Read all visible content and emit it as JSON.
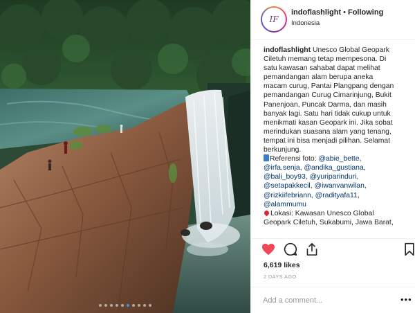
{
  "post": {
    "username": "indoflashlight",
    "separator": "•",
    "follow_label": "Following",
    "location": "Indonesia",
    "avatar_text": "IF",
    "caption": {
      "username": "indoflashlight",
      "lines": [
        " Unesco Global Geopark",
        "Ciletuh memang tetap mempesona. Di",
        "satu kawasan sahabat dapat melihat",
        "pemandangan alam berupa aneka",
        "macam curug, Pantai Plangpang dengan",
        "pemandangan Curug Cimarinjung, Bukit",
        "Panenjoan, Puncak Darma, dan masih",
        "banyak lagi. Satu hari tidak cukup untuk",
        "menikmati kasan Geopark ini. Jika sobat",
        "merindukan suasana alam yang tenang,",
        "tempat ini bisa menjadi pilihan. Selamat",
        "berkunjung."
      ],
      "credit_label": "Referensi foto: ",
      "mentions": [
        "@abie_bette",
        "@irfa.senja",
        "@andika_gustiana",
        "@bali_boy93",
        "@yuriparinduri",
        "@setapakkecil",
        "@iwanvanwilan",
        "@rizkiifebriann",
        "@radityafa11",
        "@alammumu"
      ],
      "location_label": "Lokasi: Kawasan Unesco Global",
      "location_line2": "Geopark Ciletuh, Sukabumi, Jawa Barat,"
    },
    "likes": "6,619 likes",
    "time_ago": "2 DAYS AGO",
    "comment_placeholder": "Add a comment...",
    "more_label": "•••",
    "carousel": {
      "count": 10,
      "active_index": 5
    }
  },
  "icons": {
    "like": "heart-filled-icon",
    "comment": "speech-bubble-icon",
    "share": "share-arrow-icon",
    "save": "bookmark-icon",
    "like_color": "#ed4956",
    "link_color": "#003569",
    "active_dot_color": "#3897f0"
  }
}
